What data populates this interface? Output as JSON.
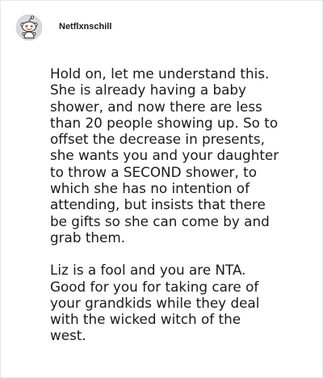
{
  "comment": {
    "username": "Netflxnschill",
    "avatar_icon": "reddit-snoo-avatar-icon",
    "paragraphs": [
      "Hold on, let me understand this.\nShe is already having a baby\nshower, and now there are less\nthan 20 people showing up. So to\noffset the decrease in presents,\nshe wants you and your daughter\nto throw a SECOND shower, to\nwhich she has no intention of\nattending, but insists that there\nbe gifts so she can come by and\ngrab them.",
      "Liz is a fool and you are NTA.\nGood for you for taking care of\nyour grandkids while they deal\nwith the wicked witch of the\nwest."
    ]
  },
  "colors": {
    "text": "#1a1a1b",
    "avatar_bg": "#dadada",
    "border": "#e8e8e8"
  }
}
